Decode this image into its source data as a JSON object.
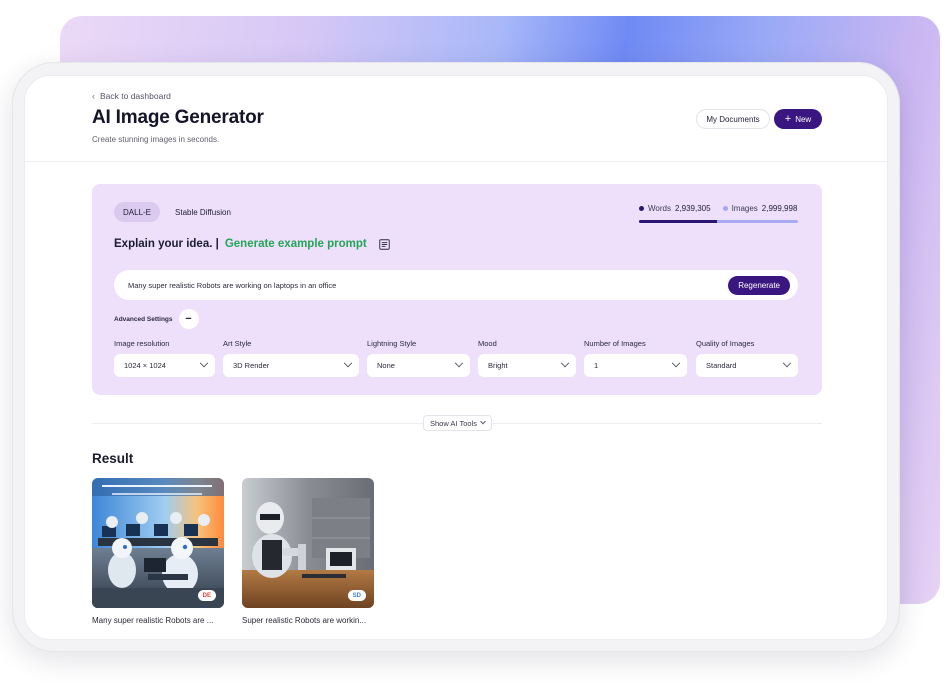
{
  "header": {
    "back_label": "Back to dashboard",
    "title": "AI Image Generator",
    "subtitle": "Create stunning images in seconds.",
    "my_documents_label": "My Documents",
    "new_label": "New"
  },
  "engine_tabs": [
    {
      "label": "DALL-E",
      "active": true
    },
    {
      "label": "Stable Diffusion",
      "active": false
    }
  ],
  "usage": {
    "words_label": "Words",
    "words_value": "2,939,305",
    "images_label": "Images",
    "images_value": "2,999,998",
    "words_fraction": 0.49
  },
  "prompt": {
    "heading": "Explain your idea. |",
    "generate_link": "Generate example prompt",
    "value": "Many super realistic Robots are working on laptops in an office",
    "regenerate_label": "Regenerate"
  },
  "advanced": {
    "label": "Advanced Settings",
    "toggle_symbol": "−"
  },
  "settings": [
    {
      "label": "Image resolution",
      "value": "1024 × 1024"
    },
    {
      "label": "Art Style",
      "value": "3D Render"
    },
    {
      "label": "Lightning Style",
      "value": "None"
    },
    {
      "label": "Mood",
      "value": "Bright"
    },
    {
      "label": "Number of Images",
      "value": "1"
    },
    {
      "label": "Quality of Images",
      "value": "Standard"
    }
  ],
  "tools": {
    "label": "Show AI Tools"
  },
  "result": {
    "title": "Result",
    "items": [
      {
        "caption": "Many super realistic Robots are ...",
        "badge": "DE",
        "badge_color": "#e0413a"
      },
      {
        "caption": "Super realistic Robots are workin...",
        "badge": "SD",
        "badge_color": "#3b7bea"
      }
    ]
  }
}
